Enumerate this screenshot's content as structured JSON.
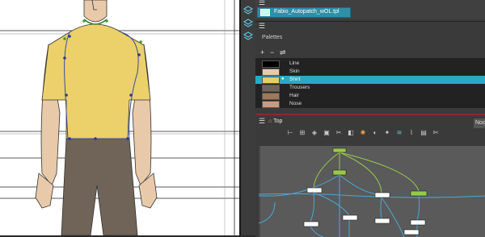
{
  "library": {
    "template_name": "Fabio_Autopatch_wOL.tpl"
  },
  "palettes": {
    "title": "Palettes",
    "tools": [
      "+",
      "−",
      "⇌"
    ],
    "swatches": [
      {
        "name": "Line",
        "color": "#000000",
        "selected": false
      },
      {
        "name": "Skin",
        "color": "#e8c9aa",
        "selected": false
      },
      {
        "name": "Shirt",
        "color": "#e8cc66",
        "selected": true
      },
      {
        "name": "Trousers",
        "color": "#6f6457",
        "selected": false
      },
      {
        "name": "Hair",
        "color": "#a07858",
        "selected": false
      },
      {
        "name": "Nose",
        "color": "#c99a80",
        "selected": false
      }
    ]
  },
  "node_view": {
    "breadcrumb": "Top",
    "right_tab": "Noc",
    "toolbar_icons": [
      "peg-icon",
      "group-icon",
      "composite-icon",
      "display-icon",
      "cutter-icon",
      "matte-icon",
      "glow-icon",
      "tone-icon",
      "highlight-icon",
      "blur-icon",
      "deformation-icon",
      "color-card-icon",
      "scissors-icon"
    ]
  },
  "colors": {
    "selection": "#2aa8c4",
    "node_border": "#8a2a2a",
    "shirt": "#ecd06a",
    "trousers": "#6f6457",
    "skin": "#e8c9aa",
    "peg_node": "#9ac84a",
    "cable": "#4aa8d8"
  }
}
